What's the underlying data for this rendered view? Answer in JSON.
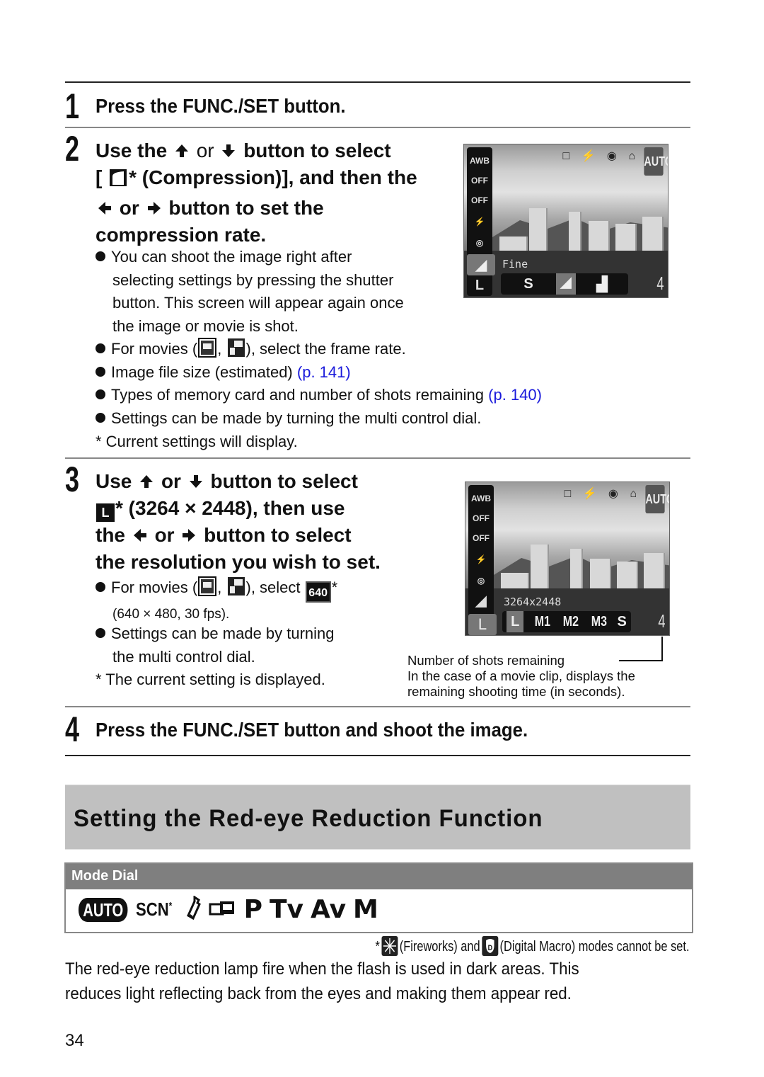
{
  "steps": [
    {
      "number": "1",
      "heading": "Press the FUNC./SET button."
    },
    {
      "number": "2",
      "heading_parts": {
        "line1_a": "Use the",
        "line1_or": "or",
        "line1_b": "button to select",
        "line2_open": "[",
        "line2_b": "* (Compression)], and then the",
        "line3_or": "or",
        "line3_b": "button to set the",
        "line4": "compression rate."
      },
      "bullets": [
        {
          "lines": [
            "You can shoot the image right after",
            "selecting settings by pressing the shutter",
            "button. This screen will appear again once",
            "the image or movie is shot."
          ]
        },
        {
          "text_a": "For movies (",
          "text_sep": ",",
          "text_b": "), select the frame rate."
        },
        {
          "text": "Image file size (estimated)",
          "link": "(p. 141)"
        },
        {
          "text": "Types of memory card and number of shots remaining",
          "link": "(p. 140)"
        },
        {
          "text": "Settings can be made by turning the multi control dial."
        }
      ],
      "note": "* Current settings will display.",
      "screen": {
        "left_icons": [
          "AWB",
          "OFF",
          "OFF",
          "⚡",
          "◎"
        ],
        "top_icons": "□ ⚡ ◉ ⌂",
        "mode_badge": "AUTO",
        "overlay_label": "Fine",
        "left_selected": "◢",
        "left_bottom": "L",
        "options": [
          "S",
          "◢",
          "▟"
        ],
        "shots_remaining": "4"
      }
    },
    {
      "number": "3",
      "heading_parts": {
        "line1_a": "Use",
        "line1_or": "or",
        "line1_b": "button to select",
        "line2_icon": "L",
        "line2_b": "* (3264 × 2448), then use",
        "line3_a": "the",
        "line3_or": "or",
        "line3_b": "button to select",
        "line4": "the resolution you wish to set."
      },
      "bullets": [
        {
          "text_a": "For movies (",
          "text_sep": ",",
          "text_b": "), select",
          "text_c": "*",
          "line2": "(640 × 480, 30 fps).",
          "icon_label": "640"
        },
        {
          "lines": [
            "Settings can be made by turning",
            "the multi control dial."
          ]
        }
      ],
      "note": "* The current setting is displayed.",
      "screen": {
        "left_icons": [
          "AWB",
          "OFF",
          "OFF",
          "⚡",
          "◎",
          "◢"
        ],
        "top_icons": "□ ⚡ ◉ ⌂",
        "mode_badge": "AUTO",
        "overlay_label": "3264x2448",
        "left_selected": "L",
        "options": [
          "L",
          "M1",
          "M2",
          "M3",
          "S"
        ],
        "shots_remaining": "4"
      },
      "caption": {
        "label": "Number of shots remaining",
        "line2": "In the case of a movie clip, displays the",
        "line3": "remaining shooting time (in seconds)."
      }
    },
    {
      "number": "4",
      "heading": "Press the FUNC./SET button and shoot the image."
    }
  ],
  "section": {
    "title": "Setting the Red-eye Reduction Function"
  },
  "mode_dial": {
    "header": "Mode Dial",
    "modes": [
      "AUTO",
      "SCN",
      "*",
      "P",
      "Tv",
      "Av",
      "M"
    ]
  },
  "footnote": {
    "star": "*",
    "fireworks": "(Fireworks) and",
    "digital_macro": "(Digital Macro) modes cannot be set."
  },
  "paragraph": {
    "line1": "The red-eye reduction lamp fire when the flash is used in dark areas. This",
    "line2": "reduces light reflecting back from the eyes and making them appear red."
  },
  "page_number": "34",
  "colors": {
    "link": "#1a1adb",
    "section_banner": "#c0c0c0",
    "mode_header": "#7f7f7f"
  }
}
